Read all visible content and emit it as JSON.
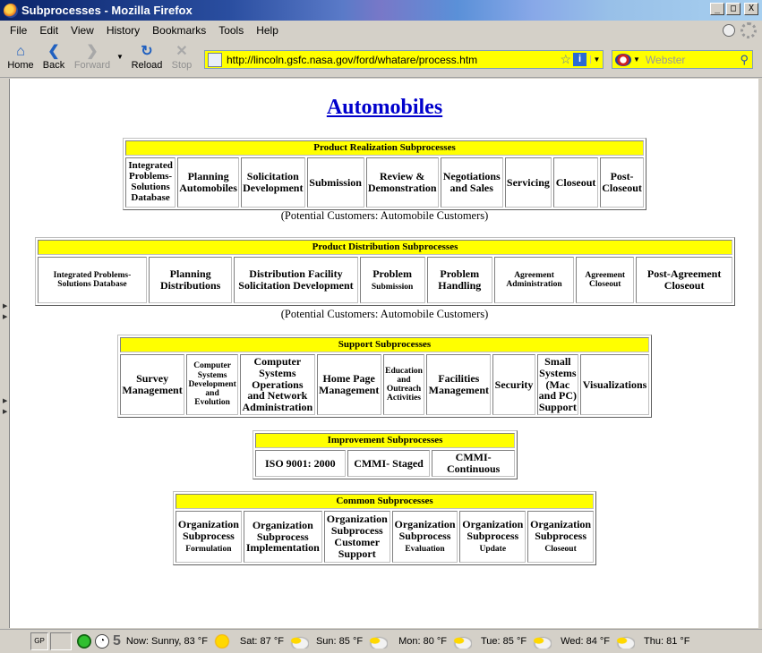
{
  "window": {
    "title": "Subprocesses - Mozilla Firefox",
    "controls": [
      "_",
      "□",
      "X"
    ]
  },
  "menu": [
    {
      "label": "File"
    },
    {
      "label": "Edit"
    },
    {
      "label": "View"
    },
    {
      "label": "History"
    },
    {
      "label": "Bookmarks"
    },
    {
      "label": "Tools"
    },
    {
      "label": "Help"
    }
  ],
  "nav": {
    "home": "Home",
    "back": "Back",
    "forward": "Forward",
    "reload": "Reload",
    "stop": "Stop",
    "url": "http://lincoln.gsfc.nasa.gov/ford/whatare/process.htm",
    "search_placeholder": "Webster"
  },
  "page": {
    "title": "Automobiles",
    "realization": {
      "header": "Product Realization Subprocesses",
      "cells": [
        "Integrated Problems-Solutions Database",
        "Planning Automobiles",
        "Solicitation Development",
        "Submission",
        "Review & Demonstration",
        "Negotiations and Sales",
        "Servicing",
        "Closeout",
        "Post-Closeout"
      ],
      "note": "(Potential Customers: Automobile Customers)"
    },
    "distribution": {
      "header": "Product Distribution Subprocesses",
      "cells": [
        "Integrated Problems-Solutions Database",
        "Planning Distributions",
        "Distribution Facility Solicitation Development",
        "Problem",
        "Submission",
        "Problem Handling",
        "Agreement Administration",
        "Agreement Closeout",
        "Post-Agreement Closeout"
      ],
      "note": "(Potential Customers: Automobile Customers)"
    },
    "support": {
      "header": "Support Subprocesses",
      "cells": [
        "Survey Management",
        "Computer Systems Development and Evolution",
        "Computer Systems Operations and Network Administration",
        "Home Page Management",
        "Education and Outreach Activities",
        "Facilities Management",
        "Security",
        "Small Systems (Mac and PC) Support",
        "Visualizations"
      ]
    },
    "improvement": {
      "header": "Improvement Subprocesses",
      "cells": [
        "ISO 9001: 2000",
        "CMMI- Staged",
        "CMMI- Continuous"
      ]
    },
    "common": {
      "header": "Common Subprocesses",
      "cells": [
        {
          "a": "Organization Subprocess",
          "b": "Formulation"
        },
        {
          "a": "Organization Subprocess Implementation",
          "b": ""
        },
        {
          "a": "Organization Subprocess Customer Support",
          "b": ""
        },
        {
          "a": "Organization Subprocess",
          "b": "Evaluation"
        },
        {
          "a": "Organization Subprocess",
          "b": "Update"
        },
        {
          "a": "Organization Subprocess",
          "b": "Closeout"
        }
      ]
    }
  },
  "statusbar": {
    "gp": "GP",
    "count": "5",
    "weather": [
      {
        "label": "Now: Sunny, 83 °F",
        "icon": "sun-icon"
      },
      {
        "label": "Sat: 87 °F",
        "icon": "partly-cloudy-icon"
      },
      {
        "label": "Sun: 85 °F",
        "icon": "partly-cloudy-icon"
      },
      {
        "label": "Mon: 80 °F",
        "icon": "partly-cloudy-icon"
      },
      {
        "label": "Tue: 85 °F",
        "icon": "partly-cloudy-icon"
      },
      {
        "label": "Wed: 84 °F",
        "icon": "partly-cloudy-icon"
      },
      {
        "label": "Thu: 81 °F",
        "icon": "partly-cloudy-icon"
      }
    ]
  }
}
